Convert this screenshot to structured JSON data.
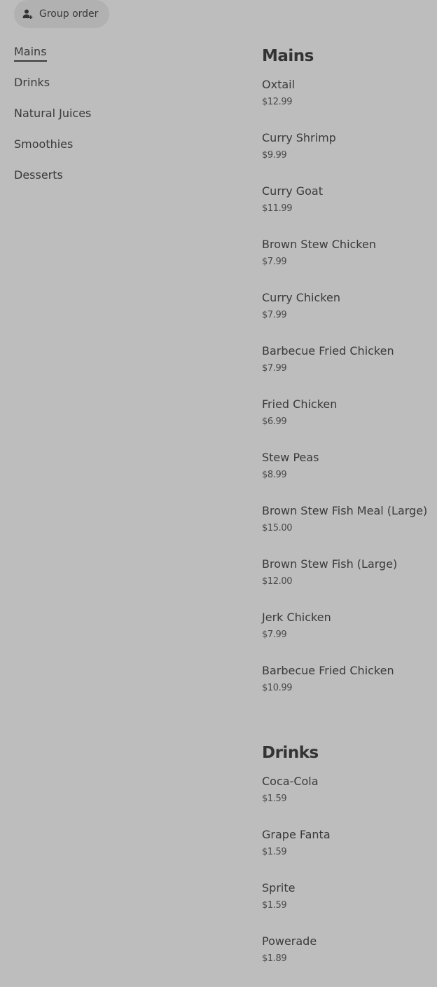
{
  "header": {
    "group_order_label": "Group order",
    "group_order_icon": "group-user-add-icon"
  },
  "nav": {
    "items": [
      {
        "label": "Mains",
        "active": true
      },
      {
        "label": "Drinks",
        "active": false
      },
      {
        "label": "Natural Juices",
        "active": false
      },
      {
        "label": "Smoothies",
        "active": false
      },
      {
        "label": "Desserts",
        "active": false
      }
    ]
  },
  "menu": {
    "sections": [
      {
        "title": "Mains",
        "items": [
          {
            "name": "Oxtail",
            "price": "$12.99"
          },
          {
            "name": "Curry Shrimp",
            "price": "$9.99"
          },
          {
            "name": "Curry Goat",
            "price": "$11.99"
          },
          {
            "name": "Brown Stew Chicken",
            "price": "$7.99"
          },
          {
            "name": "Curry Chicken",
            "price": "$7.99"
          },
          {
            "name": "Barbecue Fried Chicken",
            "price": "$7.99"
          },
          {
            "name": "Fried Chicken",
            "price": "$6.99"
          },
          {
            "name": "Stew Peas",
            "price": "$8.99"
          },
          {
            "name": "Brown Stew Fish Meal (Large)",
            "price": "$15.00"
          },
          {
            "name": "Brown Stew Fish (Large)",
            "price": "$12.00"
          },
          {
            "name": "Jerk Chicken",
            "price": "$7.99"
          },
          {
            "name": "Barbecue Fried Chicken",
            "price": "$10.99"
          }
        ]
      },
      {
        "title": "Drinks",
        "items": [
          {
            "name": "Coca-Cola",
            "price": "$1.59"
          },
          {
            "name": "Grape Fanta",
            "price": "$1.59"
          },
          {
            "name": "Sprite",
            "price": "$1.59"
          },
          {
            "name": "Powerade",
            "price": "$1.89"
          }
        ]
      }
    ]
  }
}
